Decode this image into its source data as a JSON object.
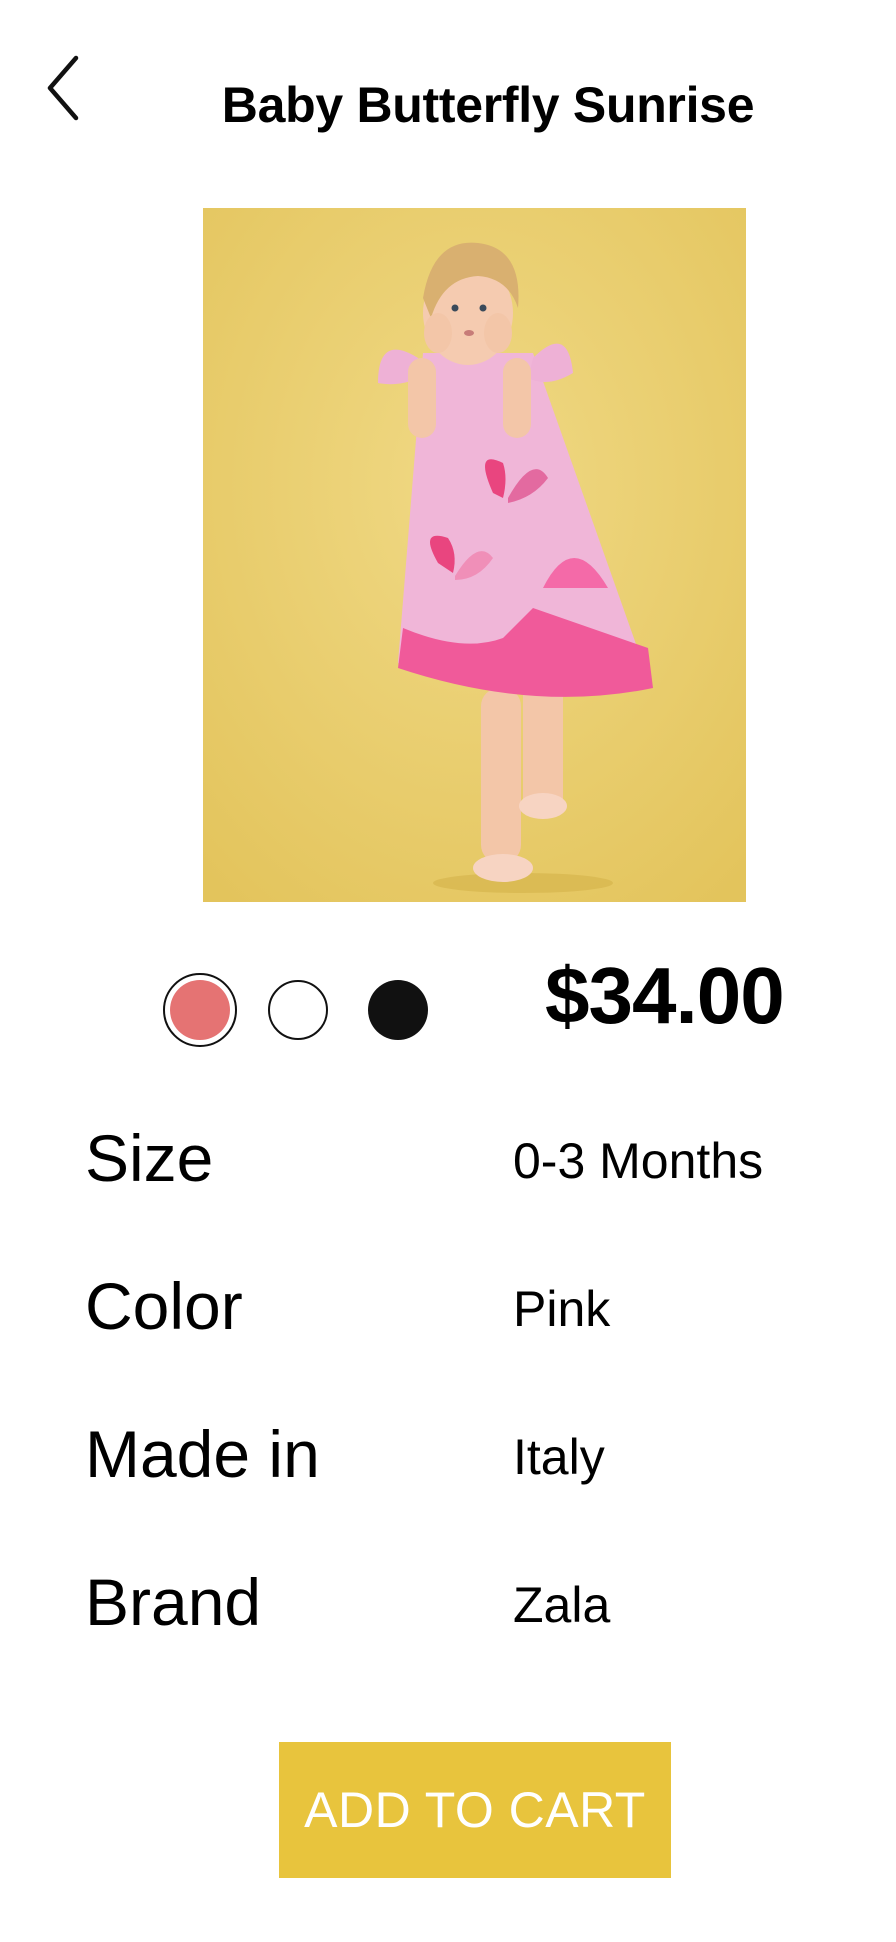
{
  "header": {
    "back_icon": "chevron-left-icon",
    "title": "Baby Butterfly Sunrise"
  },
  "product": {
    "image_icon": "product-photo",
    "price": "$34.00",
    "swatches": [
      {
        "name": "pink",
        "color": "#e57373",
        "selected": true
      },
      {
        "name": "white",
        "color": "#ffffff",
        "selected": false
      },
      {
        "name": "black",
        "color": "#111111",
        "selected": false
      }
    ]
  },
  "specs": [
    {
      "label": "Size",
      "value": "0-3 Months"
    },
    {
      "label": "Color",
      "value": "Pink"
    },
    {
      "label": "Made in",
      "value": "Italy"
    },
    {
      "label": "Brand",
      "value": "Zala"
    }
  ],
  "cart_button": {
    "label": "ADD TO CART",
    "color": "#e8c43d"
  }
}
